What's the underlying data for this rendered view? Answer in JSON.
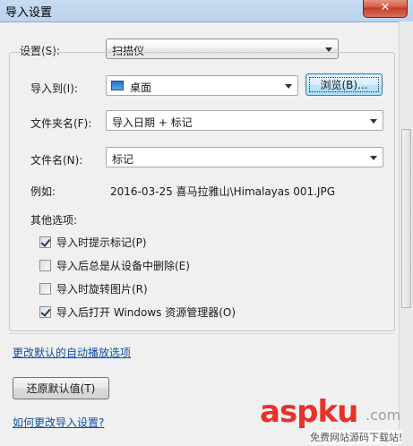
{
  "window": {
    "title": "导入设置",
    "close_glyph": "✕"
  },
  "settings": {
    "label": "设置(S):",
    "value": "扫描仪"
  },
  "import_to": {
    "label": "导入到(I):",
    "value": "桌面",
    "icon": "desktop-icon",
    "browse_label": "浏览(B)..."
  },
  "folder_name": {
    "label": "文件夹名(F):",
    "value": "导入日期 + 标记"
  },
  "file_name": {
    "label": "文件名(N):",
    "value": "标记"
  },
  "example": {
    "label": "例如:",
    "value": "2016-03-25 喜马拉雅山\\Himalayas 001.JPG"
  },
  "other_options": {
    "label": "其他选项:",
    "items": [
      {
        "label": "导入时提示标记(P)",
        "checked": true
      },
      {
        "label": "导入后总是从设备中删除(E)",
        "checked": false
      },
      {
        "label": "导入时旋转图片(R)",
        "checked": false
      },
      {
        "label": "导入后打开 Windows 资源管理器(O)",
        "checked": true
      }
    ]
  },
  "links": {
    "autoplay": "更改默认的自动播放选项",
    "help": "如何更改导入设置?"
  },
  "restore_button": "还原默认值(T)",
  "watermark": {
    "brand": "aspku",
    "tld": ".com",
    "tagline": "免费网站源码下载站!"
  }
}
